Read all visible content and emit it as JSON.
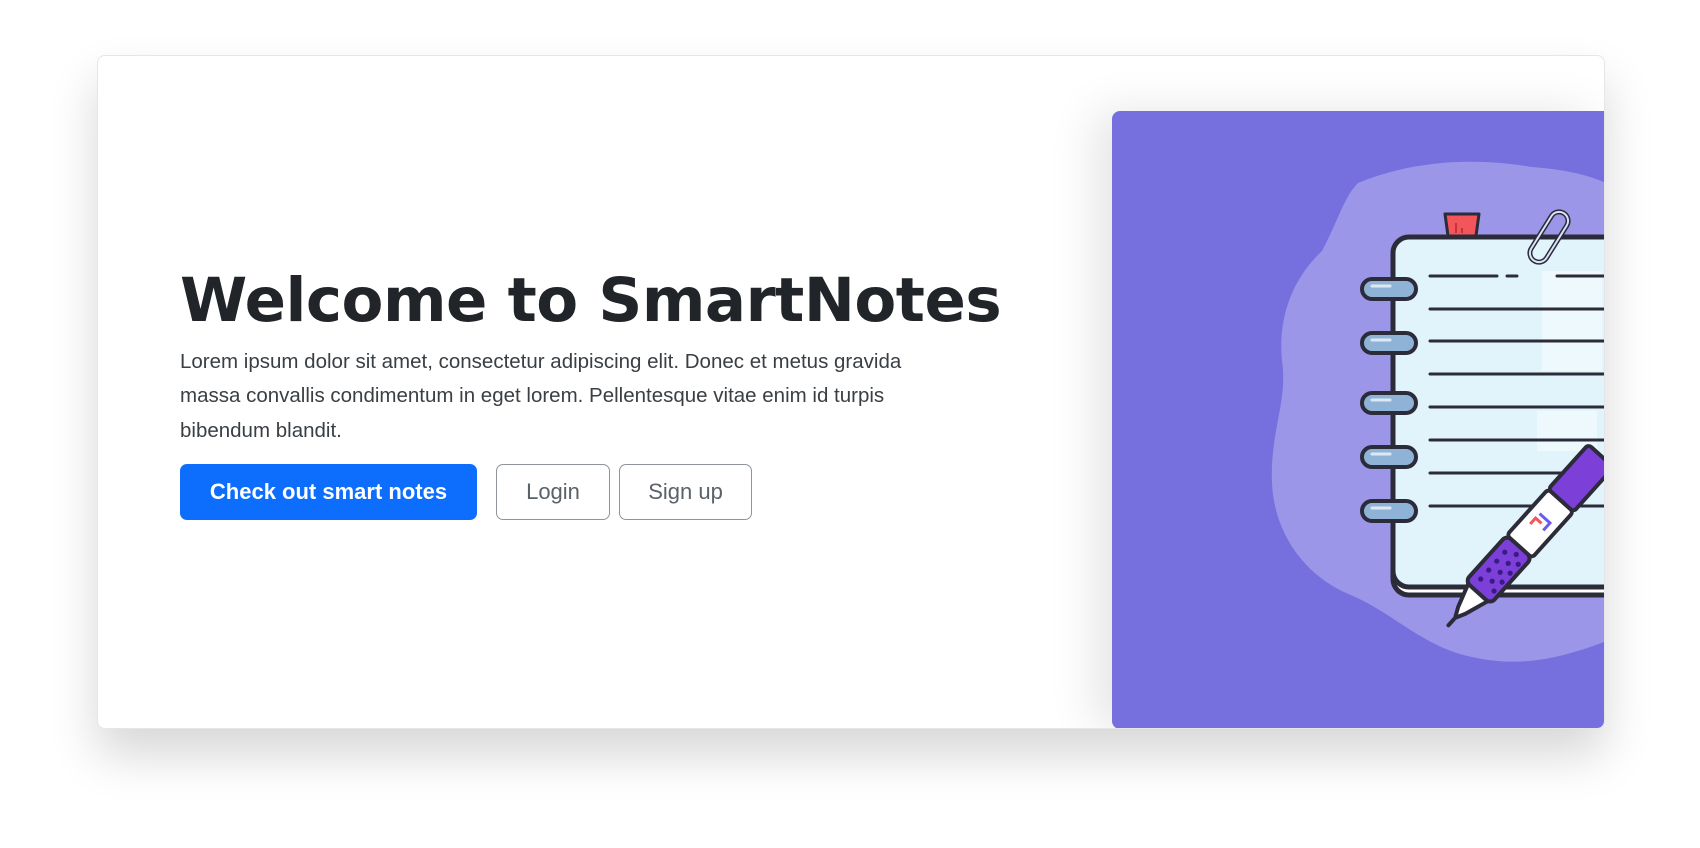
{
  "hero": {
    "title": "Welcome to SmartNotes",
    "description": "Lorem ipsum dolor sit amet, consectetur adipiscing elit. Donec et metus gravida massa convallis condimentum in eget lorem. Pellentesque vitae enim id turpis bibendum blandit.",
    "primary_button_label": "Check out smart notes",
    "login_button_label": "Login",
    "signup_button_label": "Sign up"
  },
  "illustration": {
    "name": "notebook-with-pen-illustration",
    "icons": [
      "notebook-icon",
      "pen-icon",
      "paperclip-icon",
      "bookmark-icon"
    ]
  },
  "colors": {
    "primary": "#0d6efd",
    "illustration_background": "#7670de",
    "blob": "#9c96e8",
    "notebook_page": "#e2f4fb",
    "pen": "#7c3fd8",
    "bookmark": "#f2555a"
  }
}
